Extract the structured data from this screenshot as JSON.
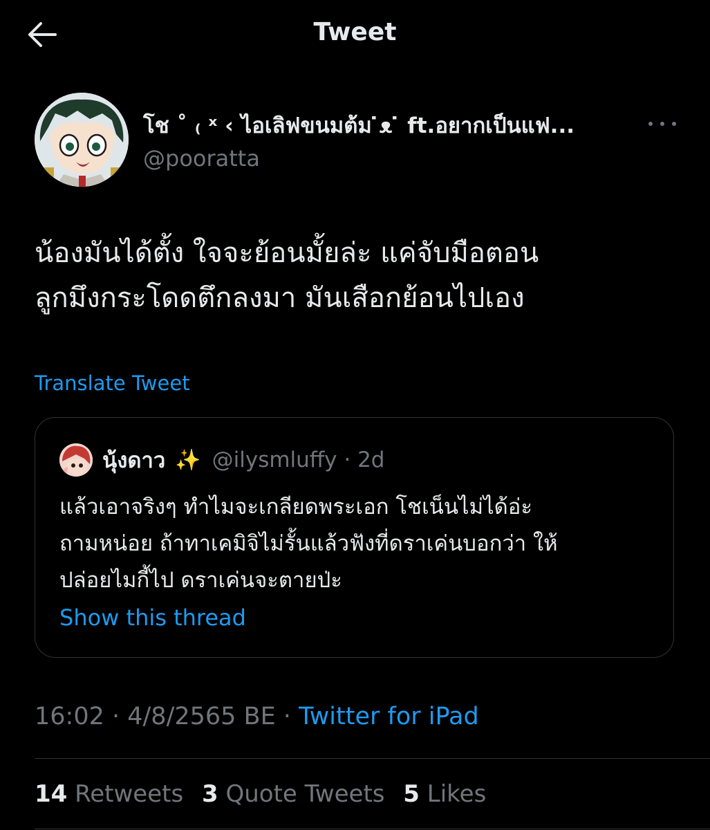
{
  "header": {
    "title": "Tweet",
    "back_icon": "arrow-left-icon"
  },
  "author": {
    "display_name": "โช ˚ ₍ ˣ ‹ ไอเลิฟขนมต้ม ̇ᴥ ̇ ft.อยากเป็นแฟ...",
    "handle": "@pooratta",
    "more_icon": "more-horizontal-icon"
  },
  "tweet": {
    "lines": [
      "น้องมันได้ตั้ง ใจจะย้อนมั้ยล่ะ แค่จับมือตอน",
      "ลูกมึงกระโดดตึกลงมา มันเสือกย้อนไปเอง"
    ],
    "translate_label": "Translate Tweet"
  },
  "quote": {
    "name": "นุ้งดาว",
    "emoji": "✨",
    "handle_time": "@ilysmluffy · 2d",
    "lines": [
      "แล้วเอาจริงๆ ทำไมจะเกลียดพระเอก โชเน็นไม่ได้อ่ะ",
      "ถามหน่อย ถ้าทาเคมิจิไม่รั้นแล้วฟังที่ดราเค่นบอกว่า ให้",
      "ปล่อยไมกี้ไป ดราเค่นจะตายป่ะ"
    ],
    "show_thread_label": "Show this thread"
  },
  "meta": {
    "time_date": "16:02 · 4/8/2565 BE · ",
    "source": "Twitter for iPad"
  },
  "stats": {
    "retweets_count": "14",
    "retweets_label": "Retweets",
    "quotes_count": "3",
    "quotes_label": "Quote Tweets",
    "likes_count": "5",
    "likes_label": "Likes"
  },
  "colors": {
    "background": "#000000",
    "text": "#e7e9ea",
    "secondary": "#71767b",
    "link": "#1d9bf0",
    "border": "#2f3336"
  }
}
